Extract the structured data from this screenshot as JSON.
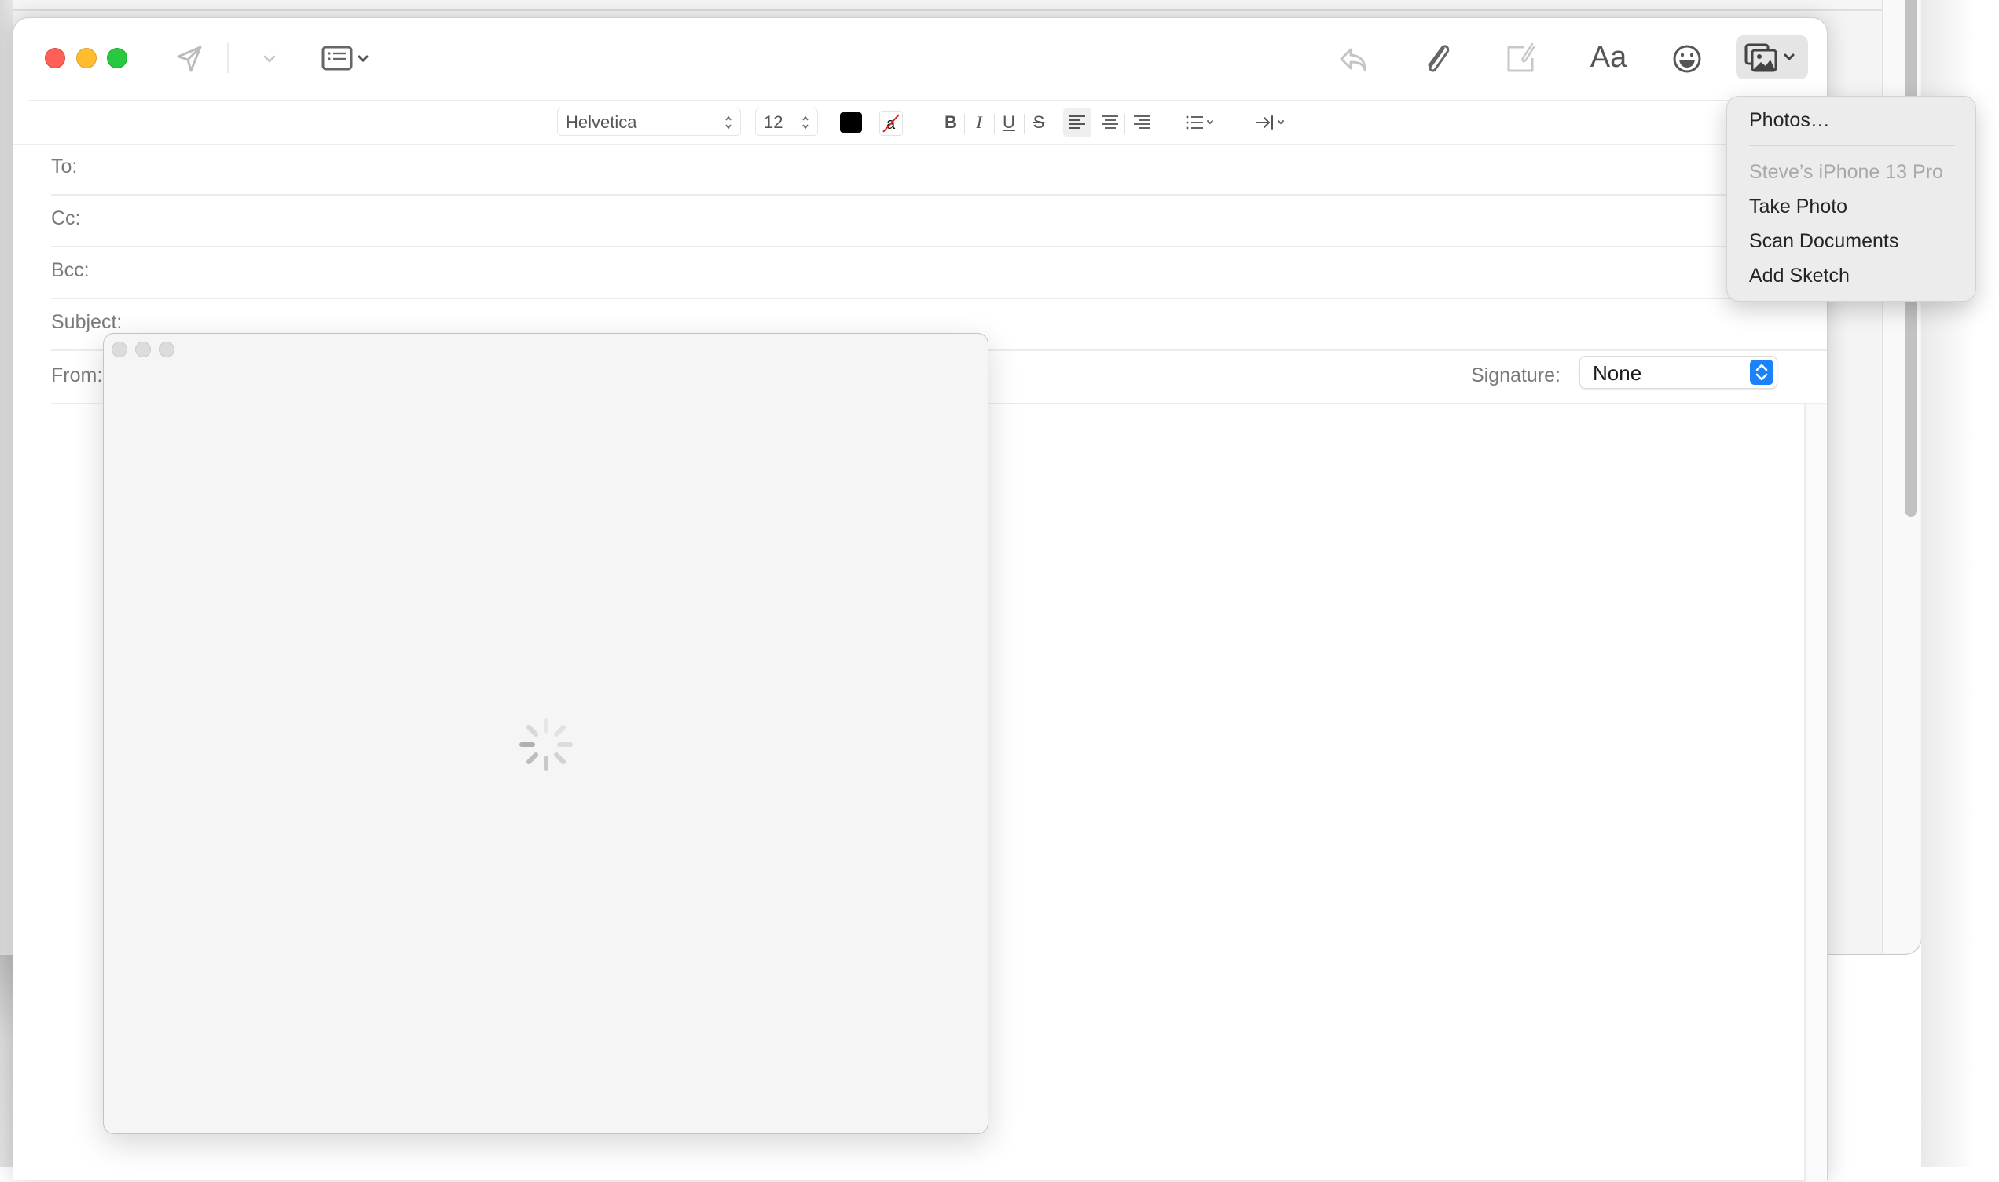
{
  "window": {
    "title_controls": [
      "close",
      "minimize",
      "zoom"
    ]
  },
  "toolbar": {
    "left": [
      {
        "icon": "paper-plane-icon",
        "label": "Send"
      },
      {
        "icon": "chevron-down-icon",
        "label": "Send options"
      },
      {
        "icon": "header-fields-icon",
        "label": "Header fields"
      }
    ],
    "right": [
      {
        "icon": "reply-icon",
        "label": "Reply"
      },
      {
        "icon": "paperclip-icon",
        "label": "Attach"
      },
      {
        "icon": "markup-attachment-icon",
        "label": "Markup"
      },
      {
        "icon": "format-text-icon",
        "label": "Aa"
      },
      {
        "icon": "emoji-icon",
        "label": "Emoji"
      },
      {
        "icon": "photo-browser-icon",
        "label": "Photos"
      }
    ],
    "format_label": "Aa"
  },
  "format_bar": {
    "font": "Helvetica",
    "size": "12",
    "text_color": "#000000",
    "bold": "B",
    "italic": "I",
    "underline": "U",
    "strike": "S",
    "alignment_selected": "left"
  },
  "fields": {
    "to_label": "To:",
    "cc_label": "Cc:",
    "bcc_label": "Bcc:",
    "subject_label": "Subject:",
    "from_label": "From:",
    "to_value": "",
    "cc_value": "",
    "bcc_value": "",
    "subject_value": ""
  },
  "signature": {
    "label": "Signature:",
    "value": "None",
    "accent": "#1a82fb"
  },
  "photo_menu": {
    "items": [
      {
        "label": "Photos…",
        "enabled": true
      },
      {
        "label": "Steve’s iPhone 13 Pro",
        "enabled": false
      },
      {
        "label": "Take Photo",
        "enabled": true
      },
      {
        "label": "Scan Documents",
        "enabled": true
      },
      {
        "label": "Add Sketch",
        "enabled": true
      }
    ]
  },
  "popup": {
    "state": "loading"
  },
  "colors": {
    "close": "#fe5f57",
    "minimize": "#febc2e",
    "zoom": "#28c840"
  }
}
